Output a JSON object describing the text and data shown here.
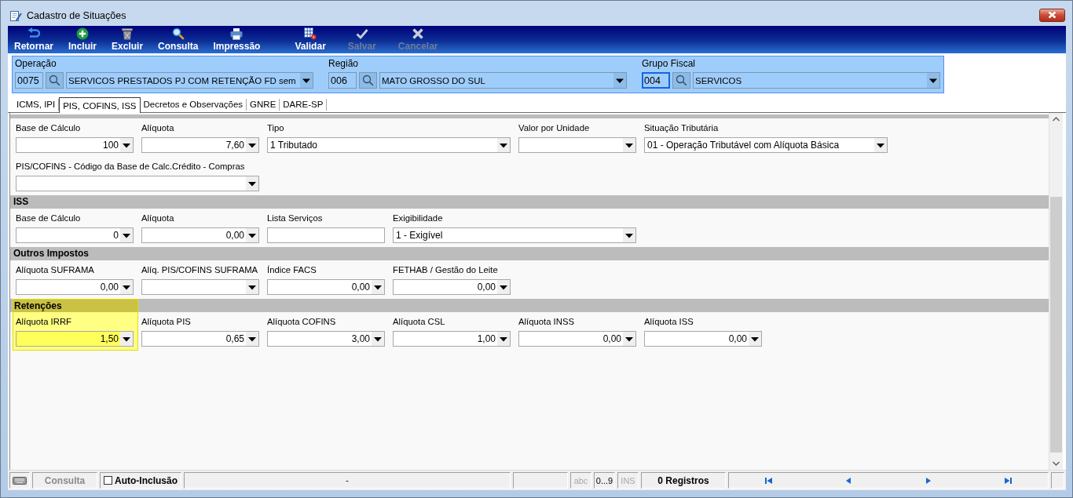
{
  "window": {
    "title": "Cadastro de Situações"
  },
  "toolbar": {
    "groups": [
      {
        "buttons": [
          {
            "kind": "back",
            "label": "Retornar",
            "disabled": false
          },
          {
            "kind": "add",
            "label": "Incluir",
            "disabled": false
          },
          {
            "kind": "delete",
            "label": "Excluir",
            "disabled": false
          },
          {
            "kind": "search",
            "label": "Consulta",
            "disabled": false
          },
          {
            "kind": "print",
            "label": "Impressão",
            "disabled": false
          }
        ]
      },
      {
        "buttons": [
          {
            "kind": "validate",
            "label": "Validar",
            "disabled": false
          },
          {
            "kind": "save",
            "label": "Salvar",
            "disabled": true
          },
          {
            "kind": "cancel",
            "label": "Cancelar",
            "disabled": true
          }
        ]
      }
    ]
  },
  "header": {
    "fields": [
      {
        "label": "Operação",
        "code": "0075",
        "value": "SERVICOS PRESTADOS PJ COM RETENÇÃO FD sem",
        "focused": false
      },
      {
        "label": "Região",
        "code": "006",
        "value": "MATO GROSSO DO SUL",
        "focused": false
      },
      {
        "label": "Grupo Fiscal",
        "code": "004",
        "value": "SERVICOS",
        "focused": true
      }
    ]
  },
  "tabs": [
    {
      "label": "ICMS, IPI",
      "selected": false
    },
    {
      "label": "PIS, COFINS, ISS",
      "selected": true
    },
    {
      "label": "Decretos e Observações",
      "selected": false
    },
    {
      "label": "GNRE",
      "selected": false
    },
    {
      "label": "DARE-SP",
      "selected": false
    }
  ],
  "form": {
    "sections": [
      {
        "highlighted": false,
        "rows": [
          {
            "fields": [
              {
                "kind": "number",
                "label": "Base de Cálculo",
                "value": "100",
                "highlighted": false
              },
              {
                "kind": "number",
                "label": "Alíquota",
                "value": "7,60",
                "highlighted": false
              },
              {
                "kind": "select",
                "label": "Tipo",
                "value": "1 Tributado",
                "highlighted": false
              },
              {
                "kind": "number",
                "label": "Valor por Unidade",
                "highlighted": false
              },
              {
                "kind": "select",
                "label": "Situação Tributária",
                "value": "01 - Operação Tributável com Alíquota Básica",
                "highlighted": false
              }
            ]
          },
          {
            "fields": [
              {
                "kind": "select",
                "label": "PIS/COFINS - Código da Base de Calc.Crédito - Compras",
                "highlighted": false
              }
            ]
          }
        ]
      },
      {
        "title": "ISS",
        "highlighted": false,
        "rows": [
          {
            "fields": [
              {
                "kind": "number",
                "label": "Base de Cálculo",
                "value": "0",
                "highlighted": false
              },
              {
                "kind": "number",
                "label": "Alíquota",
                "value": "0,00",
                "highlighted": false
              },
              {
                "kind": "text",
                "label": "Lista Serviços",
                "highlighted": false
              },
              {
                "kind": "select",
                "label": "Exigibilidade",
                "value": "1 - Exigível",
                "highlighted": false
              }
            ]
          }
        ]
      },
      {
        "title": "Outros Impostos",
        "highlighted": false,
        "rows": [
          {
            "fields": [
              {
                "kind": "number",
                "label": "Alíquota SUFRAMA",
                "value": "0,00",
                "highlighted": false
              },
              {
                "kind": "number",
                "label": "Alíq. PIS/COFINS SUFRAMA",
                "highlighted": false
              },
              {
                "kind": "number",
                "label": "Índice FACS",
                "value": "0,00",
                "highlighted": false
              },
              {
                "kind": "number",
                "label": "FETHAB / Gestão do Leite",
                "value": "0,00",
                "highlighted": false
              }
            ]
          }
        ]
      },
      {
        "title": "Retenções",
        "highlighted": true,
        "rows": [
          {
            "fields": [
              {
                "kind": "number",
                "label": "Alíquota IRRF",
                "value": "1,50",
                "highlighted": true
              },
              {
                "kind": "number",
                "label": "Alíquota PIS",
                "value": "0,65",
                "highlighted": false
              },
              {
                "kind": "number",
                "label": "Alíquota COFINS",
                "value": "3,00",
                "highlighted": false
              },
              {
                "kind": "number",
                "label": "Alíquota CSL",
                "value": "1,00",
                "highlighted": false
              },
              {
                "kind": "number",
                "label": "Alíquota INSS",
                "value": "0,00",
                "highlighted": false
              },
              {
                "kind": "number",
                "label": "Alíquota ISS",
                "value": "0,00",
                "highlighted": false
              }
            ]
          }
        ]
      }
    ]
  },
  "status_bar": {
    "mode": "Consulta",
    "auto_inclusion": {
      "label": "Auto-Inclusão",
      "checked": false
    },
    "message": "-",
    "indicators": [
      {
        "label": "abc",
        "on": false
      },
      {
        "label": "0...9",
        "on": true
      },
      {
        "label": "INS",
        "on": false
      }
    ],
    "records": "0 Registros"
  }
}
